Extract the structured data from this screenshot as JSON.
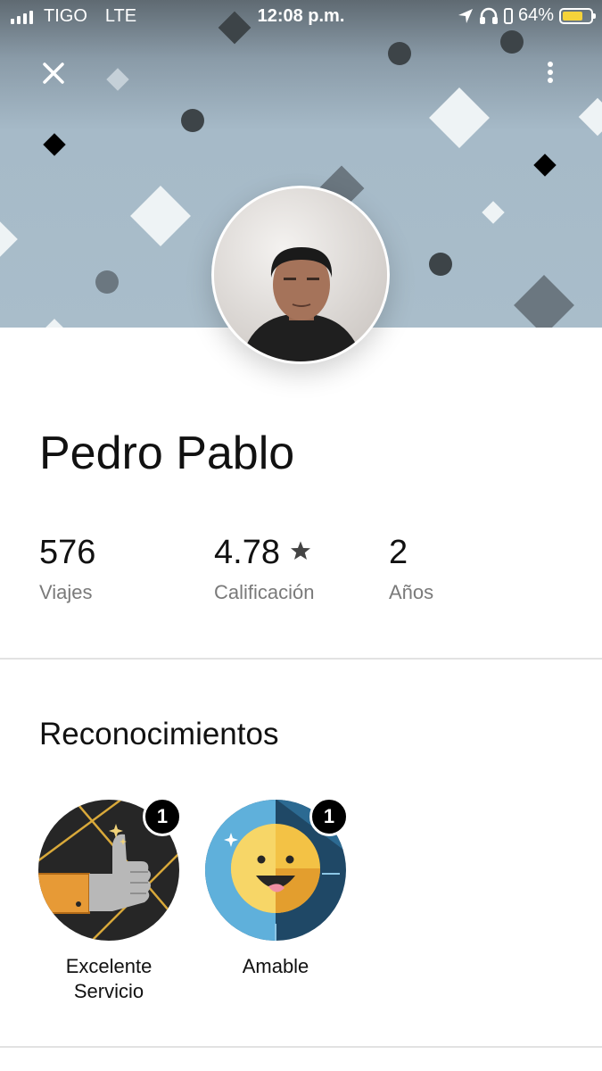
{
  "status_bar": {
    "carrier": "TIGO",
    "network": "LTE",
    "time": "12:08 p.m.",
    "battery": "64%"
  },
  "header": {
    "close_icon": "close-icon",
    "menu_icon": "more-vertical-icon"
  },
  "profile": {
    "name": "Pedro Pablo",
    "avatar": "driver-photo"
  },
  "stats": [
    {
      "value": "576",
      "label": "Viajes"
    },
    {
      "value": "4.78",
      "label": "Calificación",
      "icon": "star-icon"
    },
    {
      "value": "2",
      "label": "Años"
    }
  ],
  "recognitions": {
    "title": "Reconocimientos",
    "badges": [
      {
        "label": "Excelente Servicio",
        "count": "1",
        "icon": "thumbs-up-icon"
      },
      {
        "label": "Amable",
        "count": "1",
        "icon": "smiley-icon"
      }
    ]
  },
  "colors": {
    "header_bg": "#a9bdca",
    "battery": "#f5d33a",
    "badge_count_bg": "#000000"
  }
}
